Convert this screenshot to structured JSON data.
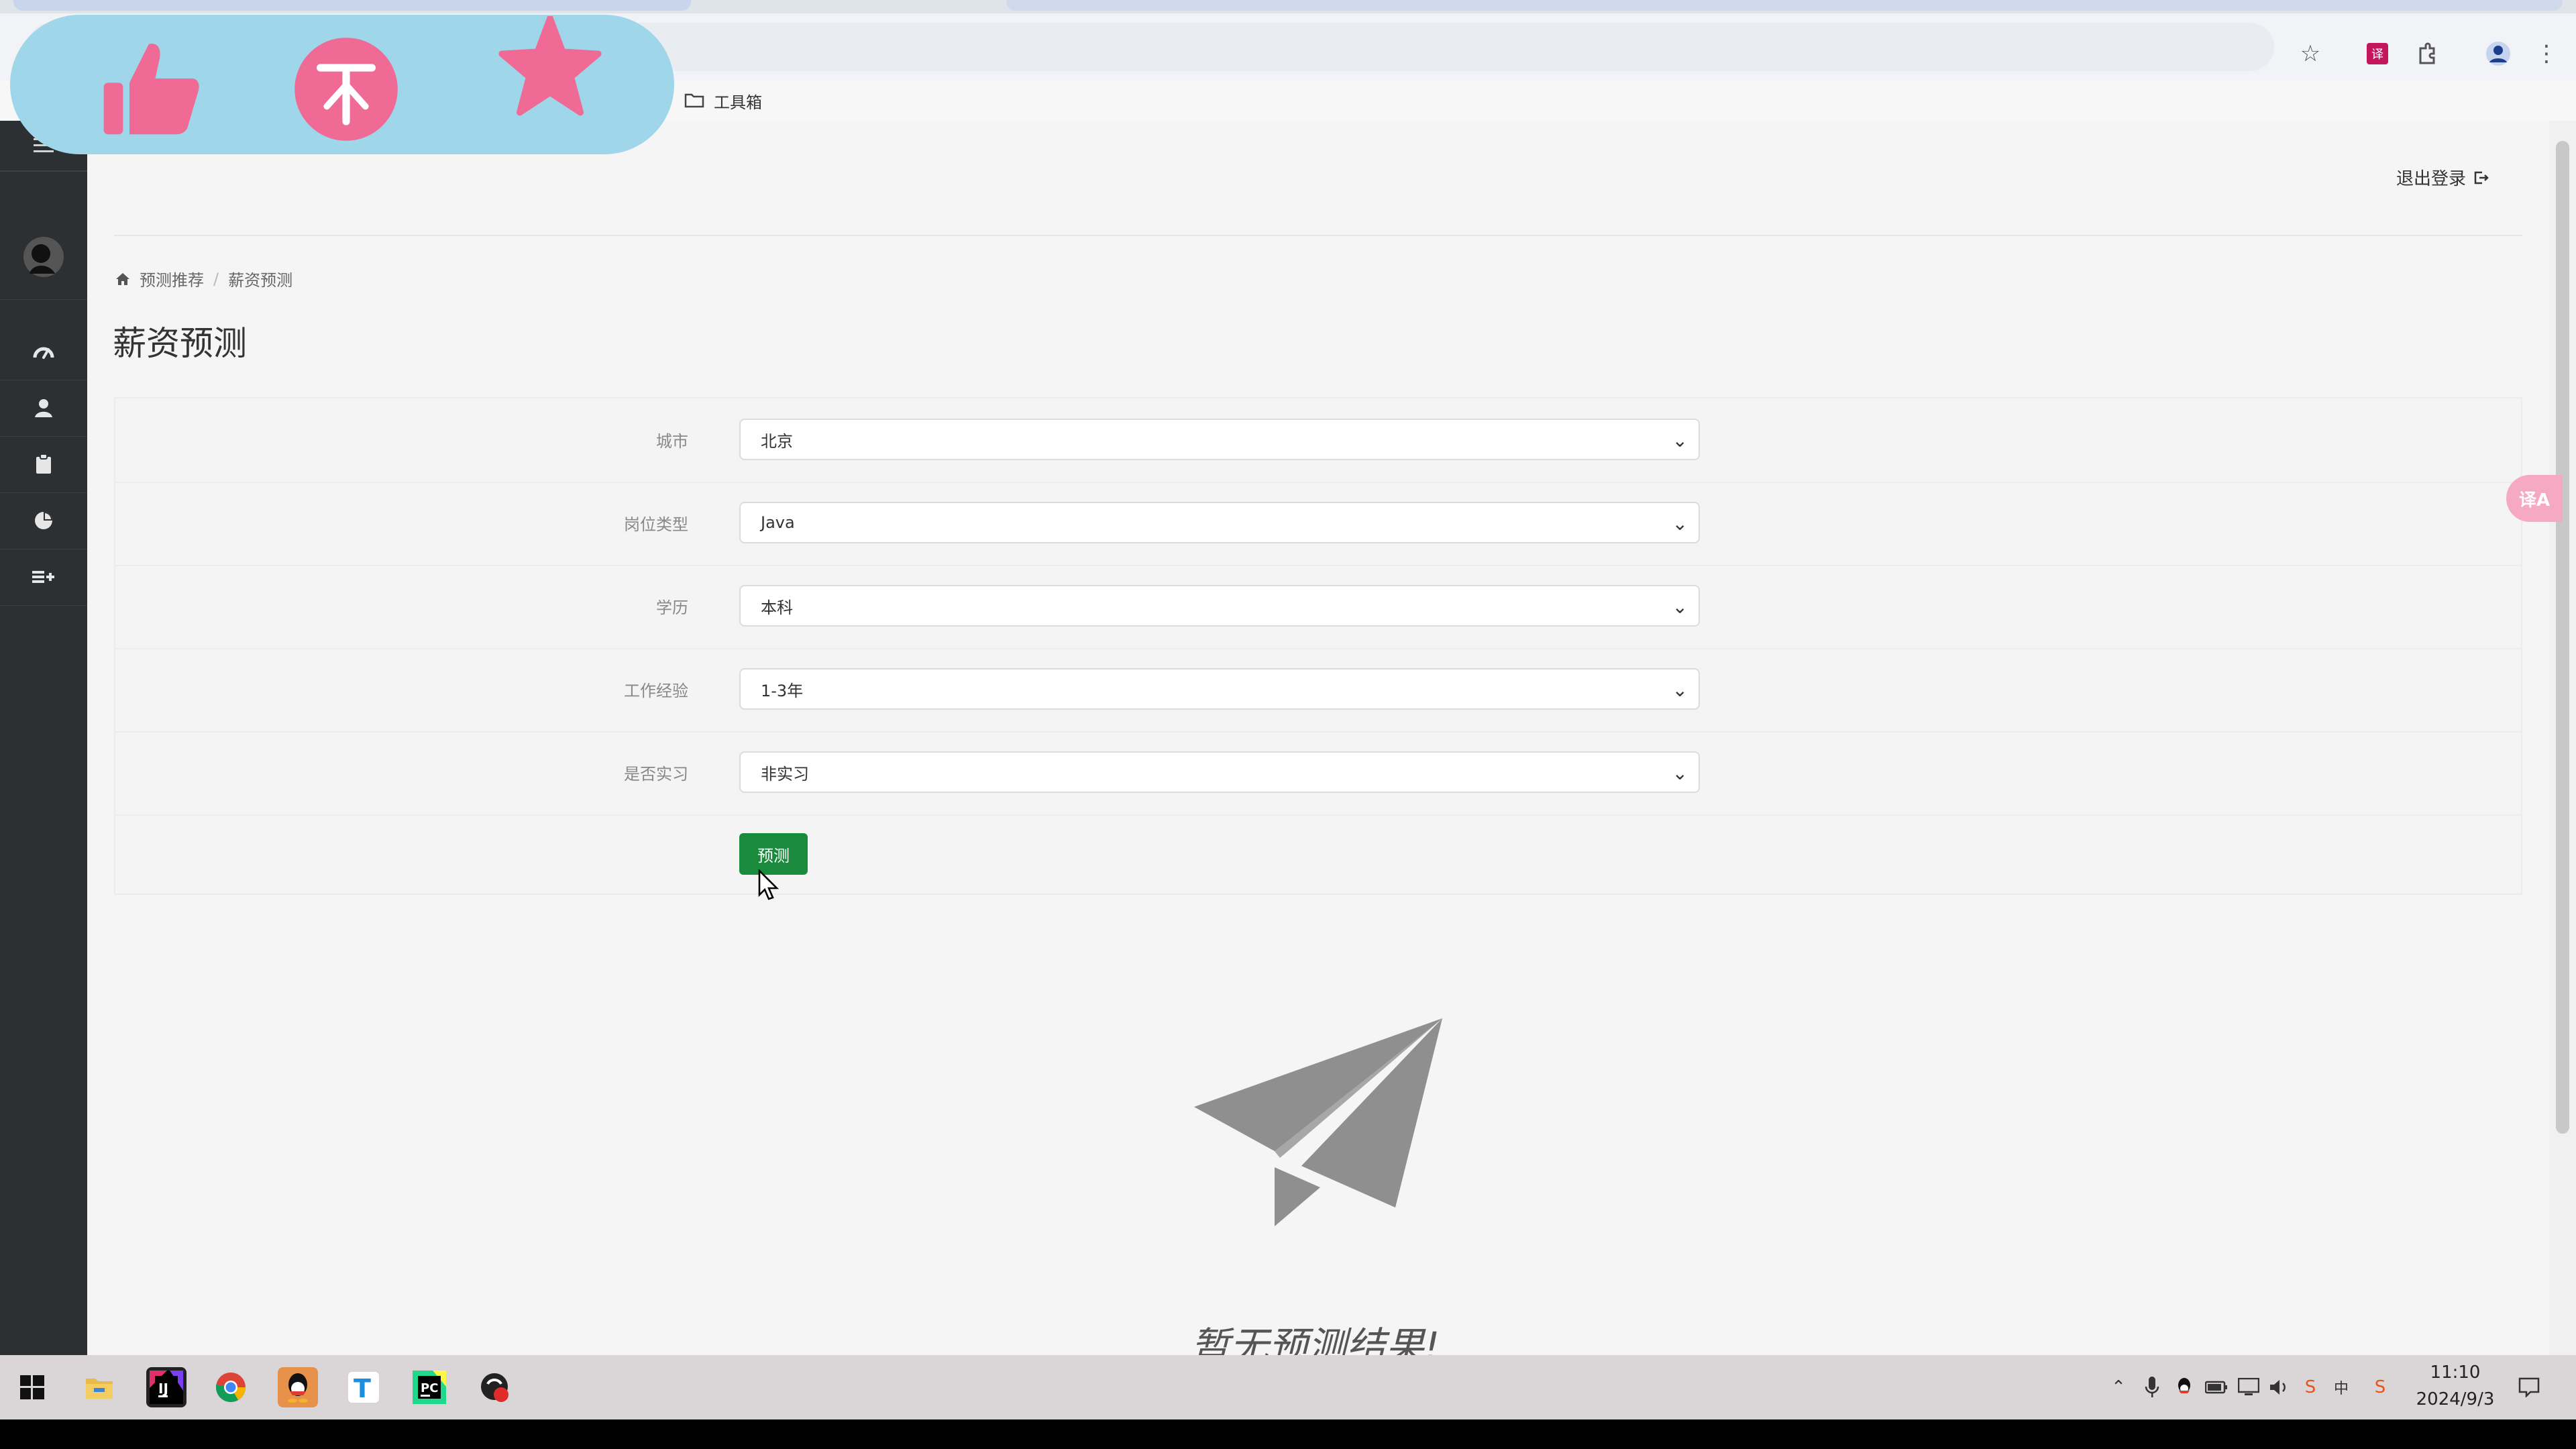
{
  "browser": {
    "bookmark_label": "工具箱"
  },
  "page": {
    "logout_label": "退出登录",
    "breadcrumb": [
      "预测推荐",
      "薪资预测"
    ],
    "title": "薪资预测",
    "form": [
      {
        "label": "城市",
        "value": "北京"
      },
      {
        "label": "岗位类型",
        "value": "Java"
      },
      {
        "label": "学历",
        "value": "本科"
      },
      {
        "label": "工作经验",
        "value": "1-3年"
      },
      {
        "label": "是否实习",
        "value": "非实习"
      }
    ],
    "predict_button": "预测",
    "empty_result": "暂无预测结果!",
    "translate_badge": "译A"
  },
  "sidebar": {
    "icons": [
      "menu-icon",
      "avatar",
      "dashboard-icon",
      "user-icon",
      "clipboard-icon",
      "pie-chart-icon",
      "add-list-icon"
    ]
  },
  "overlay": {
    "icons": [
      "thumbs-up-icon",
      "coin-icon",
      "star-icon"
    ],
    "colors": {
      "background": "#9fd6ea",
      "accent": "#ef6a94"
    }
  },
  "taskbar": {
    "apps": [
      "windows-start-icon",
      "file-explorer-icon",
      "intellij-icon",
      "chrome-icon",
      "qq-icon",
      "typora-icon",
      "pycharm-icon",
      "app-icon"
    ],
    "time": "11:10",
    "date": "2024/9/3"
  },
  "colors": {
    "sidebar": "#2c3033",
    "primary_button": "#1a8a3c",
    "page_bg": "#f5f5f5"
  }
}
